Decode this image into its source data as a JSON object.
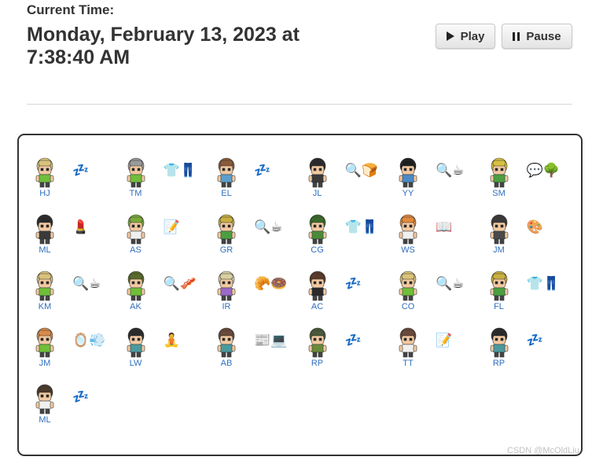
{
  "header": {
    "time_label": "Current Time:",
    "time_value": "Monday, February 13, 2023 at 7:38:40 AM"
  },
  "controls": {
    "play_label": "Play",
    "pause_label": "Pause"
  },
  "agents": [
    {
      "initials": "HJ",
      "hair": "#d9c27a",
      "shirt": "#6fbf3a",
      "status": "💤"
    },
    {
      "initials": "TM",
      "hair": "#9a9a9a",
      "shirt": "#6fbf3a",
      "status": "👕👖"
    },
    {
      "initials": "EL",
      "hair": "#8a5a3a",
      "shirt": "#5aa0d0",
      "status": "💤"
    },
    {
      "initials": "JL",
      "hair": "#2a2a2a",
      "shirt": "#3a3a3a",
      "status": "🔍🍞"
    },
    {
      "initials": "YY",
      "hair": "#1e1e1e",
      "shirt": "#4a8ac8",
      "status": "🔍☕"
    },
    {
      "initials": "SM",
      "hair": "#d8c040",
      "shirt": "#4aa040",
      "status": "💬🌳"
    },
    {
      "initials": "ML",
      "hair": "#2a2a2a",
      "shirt": "#3a3a3a",
      "status": "💄"
    },
    {
      "initials": "AS",
      "hair": "#7aaa3a",
      "shirt": "#f0f0f0",
      "status": "📝"
    },
    {
      "initials": "GR",
      "hair": "#c8b040",
      "shirt": "#4aa040",
      "status": "🔍☕"
    },
    {
      "initials": "CG",
      "hair": "#3a6a2a",
      "shirt": "#4a8a3a",
      "status": "👕👖"
    },
    {
      "initials": "WS",
      "hair": "#e08a3a",
      "shirt": "#f0f0f0",
      "status": "📖"
    },
    {
      "initials": "JM",
      "hair": "#3a3a3a",
      "shirt": "#4a4a4a",
      "status": "🎨"
    },
    {
      "initials": "KM",
      "hair": "#d9c27a",
      "shirt": "#6fbf3a",
      "status": "🔍☕"
    },
    {
      "initials": "AK",
      "hair": "#5a6a2a",
      "shirt": "#6fbf3a",
      "status": "🔍🥓"
    },
    {
      "initials": "IR",
      "hair": "#d8d0a0",
      "shirt": "#9a6ac8",
      "status": "🥐🍩"
    },
    {
      "initials": "AC",
      "hair": "#5a3a2a",
      "shirt": "#2a2a2a",
      "status": "💤"
    },
    {
      "initials": "CO",
      "hair": "#d9c27a",
      "shirt": "#6fbf3a",
      "status": "🔍☕"
    },
    {
      "initials": "FL",
      "hair": "#c8b040",
      "shirt": "#4aa040",
      "status": "👕👖"
    },
    {
      "initials": "JM",
      "hair": "#d88a4a",
      "shirt": "#6fbf3a",
      "status": "🪞💨"
    },
    {
      "initials": "LW",
      "hair": "#2a2a2a",
      "shirt": "#4a9aa0",
      "status": "🧘"
    },
    {
      "initials": "AB",
      "hair": "#6a4a3a",
      "shirt": "#4a9aa0",
      "status": "📰💻"
    },
    {
      "initials": "RP",
      "hair": "#4a5a3a",
      "shirt": "#6a8a3a",
      "status": "💤"
    },
    {
      "initials": "TT",
      "hair": "#6a4a3a",
      "shirt": "#f0f0f0",
      "status": "📝"
    },
    {
      "initials": "RP",
      "hair": "#2a2a2a",
      "shirt": "#4a9aa0",
      "status": "💤"
    },
    {
      "initials": "ML",
      "hair": "#4a3a2a",
      "shirt": "#f0f0f0",
      "status": "💤"
    }
  ],
  "watermark": "CSDN @McOldLiu"
}
